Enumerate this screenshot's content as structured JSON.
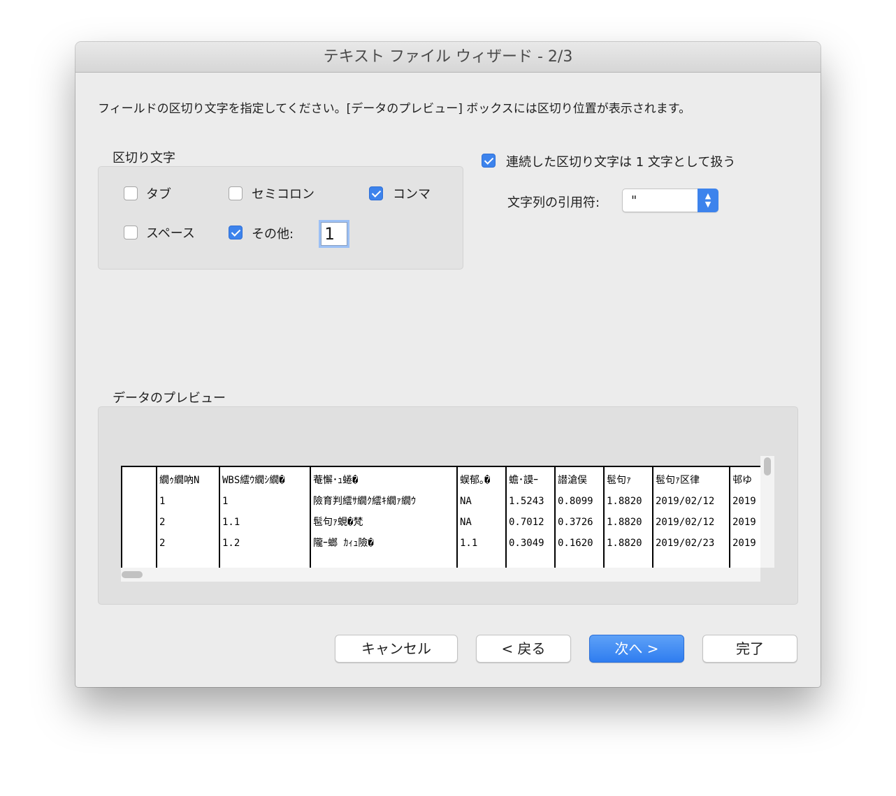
{
  "window": {
    "title": "テキスト ファイル ウィザード - 2/3"
  },
  "instruction": "フィールドの区切り文字を指定してください。[データのプレビュー] ボックスには区切り位置が表示されます。",
  "delimiters": {
    "group_label": "区切り文字",
    "tab": {
      "label": "タブ",
      "checked": false
    },
    "semicolon": {
      "label": "セミコロン",
      "checked": false
    },
    "comma": {
      "label": "コンマ",
      "checked": true
    },
    "space": {
      "label": "スペース",
      "checked": false
    },
    "other": {
      "label": "その他:",
      "checked": true,
      "value": "1"
    }
  },
  "options": {
    "treat_consecutive": {
      "label": "連続した区切り文字は 1 文字として扱う",
      "checked": true
    },
    "text_qualifier": {
      "label": "文字列の引用符:",
      "value": "\""
    }
  },
  "preview": {
    "label": "データのプレビュー",
    "rows": [
      [
        "",
        "繝ｩ繝吶Ν",
        "WBS繧ｳ繝ｼ繝�",
        "菴懈･ｭ蜷�",
        "蜈郁｡�",
        "蟾･謨ｰ",
        "譛滄俣",
        "髢句ｧ",
        "髢句ｧ区律",
        "邨ゆ"
      ],
      [
        "",
        "1",
        "1",
        "險育判繧ｻ繝ｸ繧ｷ繝ｧ繝ｳ",
        "NA",
        "1.5243",
        "0.8099",
        "1.8820",
        "2019/02/12",
        "2019"
      ],
      [
        "",
        "2",
        "1.1",
        "髢句ｧ蜆�梵",
        "NA",
        "0.7012",
        "0.3726",
        "1.8820",
        "2019/02/12",
        "2019"
      ],
      [
        "",
        "2",
        "1.2",
        "隴ｰ螂 ｶｨｭ險�",
        "1.1",
        "0.3049",
        "0.1620",
        "1.8820",
        "2019/02/23",
        "2019"
      ]
    ]
  },
  "buttons": {
    "cancel": "キャンセル",
    "back": "< 戻る",
    "next": "次へ >",
    "finish": "完了"
  },
  "colors": {
    "accent": "#3d83ec",
    "window_bg": "#ececec"
  }
}
